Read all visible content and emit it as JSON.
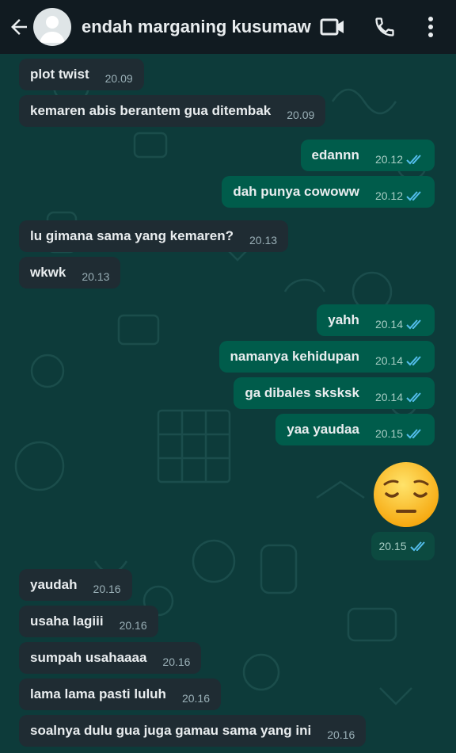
{
  "header": {
    "contact_name": "endah marganing kusumaw...",
    "icons": [
      "back-arrow-icon",
      "avatar",
      "video-call-icon",
      "phone-icon",
      "more-options-icon"
    ]
  },
  "colors": {
    "header_bg": "#111b21",
    "chat_bg": "#0d3b3a",
    "incoming_bubble": "#1f2c33",
    "outgoing_bubble": "#005c4b",
    "read_ticks": "#53bdeb"
  },
  "messages": [
    {
      "direction": "in",
      "text": "plot twist",
      "time": "20.09"
    },
    {
      "direction": "in",
      "text": "kemaren abis berantem gua ditembak",
      "time": "20.09"
    },
    {
      "direction": "out",
      "text": "edannn",
      "time": "20.12",
      "status": "read"
    },
    {
      "direction": "out",
      "text": "dah punya cowoww",
      "time": "20.12",
      "status": "read"
    },
    {
      "direction": "in",
      "text": "lu gimana sama yang kemaren?",
      "time": "20.13"
    },
    {
      "direction": "in",
      "text": "wkwk",
      "time": "20.13"
    },
    {
      "direction": "out",
      "text": "yahh",
      "time": "20.14",
      "status": "read"
    },
    {
      "direction": "out",
      "text": "namanya kehidupan",
      "time": "20.14",
      "status": "read"
    },
    {
      "direction": "out",
      "text": "ga dibales sksksk",
      "time": "20.14",
      "status": "read"
    },
    {
      "direction": "out",
      "text": "yaa yaudaa",
      "time": "20.15",
      "status": "read"
    },
    {
      "direction": "out",
      "text": "",
      "sticker": "pensive-face-emoji",
      "time": "20.15",
      "status": "read"
    },
    {
      "direction": "in",
      "text": "yaudah",
      "time": "20.16"
    },
    {
      "direction": "in",
      "text": "usaha lagiii",
      "time": "20.16"
    },
    {
      "direction": "in",
      "text": "sumpah usahaaaa",
      "time": "20.16"
    },
    {
      "direction": "in",
      "text": "lama lama pasti luluh",
      "time": "20.16"
    },
    {
      "direction": "in",
      "text": "soalnya dulu gua juga gamau sama yang ini",
      "time": "20.16"
    }
  ]
}
